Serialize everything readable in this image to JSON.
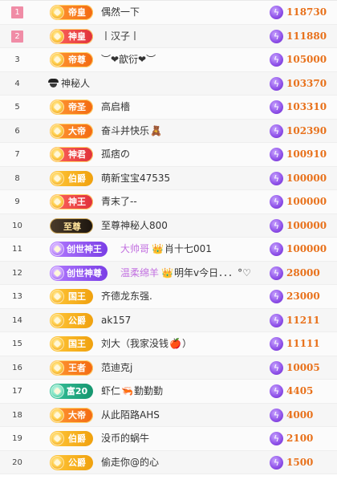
{
  "leaderboard": {
    "rows": [
      {
        "rank": "1",
        "badge": "帝皇",
        "badge_style": "b-orange",
        "name_prefix": "",
        "name": "偶然一下",
        "deco": "",
        "name_suffix": "",
        "score": "118730"
      },
      {
        "rank": "2",
        "badge": "神皇",
        "badge_style": "b-red",
        "name_prefix": "",
        "name": "丨汉子丨",
        "deco": "",
        "name_suffix": "",
        "score": "111880"
      },
      {
        "rank": "3",
        "badge": "帝尊",
        "badge_style": "b-orange",
        "name_prefix": "",
        "name": "︶❤歆衍❤︶",
        "deco": "",
        "name_suffix": "",
        "score": "105000"
      },
      {
        "rank": "4",
        "badge": "",
        "badge_style": "",
        "name_prefix": "",
        "name": "神秘人",
        "deco": "",
        "name_suffix": "",
        "score": "103370",
        "incognito": true
      },
      {
        "rank": "5",
        "badge": "帝圣",
        "badge_style": "b-orange",
        "name_prefix": "",
        "name": "高启檣",
        "deco": "",
        "name_suffix": "",
        "score": "103310"
      },
      {
        "rank": "6",
        "badge": "大帝",
        "badge_style": "b-orange",
        "name_prefix": "",
        "name": "奋斗并快乐",
        "deco": "🧸",
        "name_suffix": "",
        "score": "102390"
      },
      {
        "rank": "7",
        "badge": "神君",
        "badge_style": "b-red",
        "name_prefix": "",
        "name": "孤痞の",
        "deco": "",
        "name_suffix": "",
        "score": "100910"
      },
      {
        "rank": "8",
        "badge": "伯爵",
        "badge_style": "b-gold",
        "name_prefix": "",
        "name": "萌新宝宝47535",
        "deco": "",
        "name_suffix": "",
        "score": "100000"
      },
      {
        "rank": "9",
        "badge": "神王",
        "badge_style": "b-red",
        "name_prefix": "",
        "name": "青末了--",
        "deco": "",
        "name_suffix": "",
        "score": "100000"
      },
      {
        "rank": "10",
        "badge": "至尊",
        "badge_style": "b-dark",
        "name_prefix": "",
        "name": "至尊神秘人800",
        "deco": "",
        "name_suffix": "",
        "score": "100000"
      },
      {
        "rank": "11",
        "badge": "创世神王",
        "badge_style": "b-purple",
        "name_prefix": "大帅哥",
        "name": "肖十七001",
        "deco": "👑",
        "name_suffix": "",
        "score": "100000"
      },
      {
        "rank": "12",
        "badge": "创世神尊",
        "badge_style": "b-purple",
        "name_prefix": "温柔绵羊",
        "name": "明年v今日．．．°♡",
        "deco": "👑",
        "name_suffix": "",
        "score": "28000"
      },
      {
        "rank": "13",
        "badge": "国王",
        "badge_style": "b-gold",
        "name_prefix": "",
        "name": "齐德龙东强.",
        "deco": "",
        "name_suffix": "",
        "score": "23000"
      },
      {
        "rank": "14",
        "badge": "公爵",
        "badge_style": "b-gold",
        "name_prefix": "",
        "name": "ak157",
        "deco": "",
        "name_suffix": "",
        "score": "11211"
      },
      {
        "rank": "15",
        "badge": "国王",
        "badge_style": "b-gold",
        "name_prefix": "",
        "name": "刘大（我家没钱",
        "deco": "🍎",
        "name_suffix": "）",
        "score": "11111"
      },
      {
        "rank": "16",
        "badge": "王者",
        "badge_style": "b-orange",
        "name_prefix": "",
        "name": "范迪克j",
        "deco": "",
        "name_suffix": "",
        "score": "10005"
      },
      {
        "rank": "17",
        "badge": "富20",
        "badge_style": "b-teal",
        "name_prefix": "",
        "name": "虾仁",
        "deco": "🦐",
        "name_suffix": "勤勤勤",
        "score": "4405"
      },
      {
        "rank": "18",
        "badge": "大帝",
        "badge_style": "b-orange",
        "name_prefix": "",
        "name": "从此陌路AHS",
        "deco": "",
        "name_suffix": "",
        "score": "4000"
      },
      {
        "rank": "19",
        "badge": "伯爵",
        "badge_style": "b-gold",
        "name_prefix": "",
        "name": "没币的蜗牛",
        "deco": "",
        "name_suffix": "",
        "score": "2100"
      },
      {
        "rank": "20",
        "badge": "公爵",
        "badge_style": "b-gold",
        "name_prefix": "",
        "name": "偷走你@的心",
        "deco": "",
        "name_suffix": "",
        "score": "1500"
      }
    ],
    "score_icon": "lightning-bolt-icon",
    "top_rank_color": "#f08ca6",
    "score_color": "#e8711b"
  }
}
